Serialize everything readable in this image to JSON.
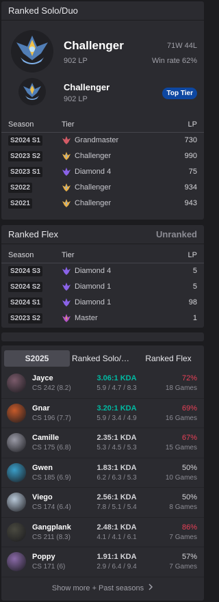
{
  "solo": {
    "title": "Ranked Solo/Duo",
    "tier": "Challenger",
    "lp": "902 LP",
    "record": "71W 44L",
    "winrate": "Win rate 62%",
    "secondary_tier": "Challenger",
    "secondary_lp": "902 LP",
    "badge": "Top Tier",
    "headers": {
      "season": "Season",
      "tier": "Tier",
      "lp": "LP"
    },
    "rows": [
      {
        "season": "S2024 S1",
        "tier": "Grandmaster",
        "lp": "730",
        "icon": "grandmaster-icon",
        "color": "#d35b66"
      },
      {
        "season": "S2023 S2",
        "tier": "Challenger",
        "lp": "990",
        "icon": "challenger-icon",
        "color": "#e8b04a"
      },
      {
        "season": "S2023 S1",
        "tier": "Diamond 4",
        "lp": "75",
        "icon": "diamond-icon",
        "color": "#8a63e8"
      },
      {
        "season": "S2022",
        "tier": "Challenger",
        "lp": "934",
        "icon": "challenger-icon",
        "color": "#e8b04a"
      },
      {
        "season": "S2021",
        "tier": "Challenger",
        "lp": "943",
        "icon": "challenger-icon",
        "color": "#e8b04a"
      }
    ]
  },
  "flex": {
    "title": "Ranked Flex",
    "status": "Unranked",
    "headers": {
      "season": "Season",
      "tier": "Tier",
      "lp": "LP"
    },
    "rows": [
      {
        "season": "S2024 S3",
        "tier": "Diamond 4",
        "lp": "5",
        "icon": "diamond-icon",
        "color": "#8a63e8"
      },
      {
        "season": "S2024 S2",
        "tier": "Diamond 1",
        "lp": "5",
        "icon": "diamond-icon",
        "color": "#8a63e8"
      },
      {
        "season": "S2024 S1",
        "tier": "Diamond 1",
        "lp": "98",
        "icon": "diamond-icon",
        "color": "#8a63e8"
      },
      {
        "season": "S2023 S2",
        "tier": "Master",
        "lp": "1",
        "icon": "master-icon",
        "color": "#b555c7"
      }
    ]
  },
  "champions": {
    "tabs": [
      "S2025",
      "Ranked Solo/D...",
      "Ranked Flex"
    ],
    "list": [
      {
        "name": "Jayce",
        "cs": "CS 242 (8.2)",
        "kda": "3.06:1 KDA",
        "kda_detail": "5.9 / 4.7 / 8.3",
        "winrate": "72%",
        "games": "18 Games",
        "kda_hl": true,
        "wr_hot": true,
        "color": "#7a5a6a"
      },
      {
        "name": "Gnar",
        "cs": "CS 196 (7.7)",
        "kda": "3.20:1 KDA",
        "kda_detail": "5.9 / 3.4 / 4.9",
        "winrate": "69%",
        "games": "16 Games",
        "kda_hl": true,
        "wr_hot": true,
        "color": "#c65a2a"
      },
      {
        "name": "Camille",
        "cs": "CS 175 (6.8)",
        "kda": "2.35:1 KDA",
        "kda_detail": "5.3 / 4.5 / 5.3",
        "winrate": "67%",
        "games": "15 Games",
        "kda_hl": false,
        "wr_hot": true,
        "color": "#9a9aa6"
      },
      {
        "name": "Gwen",
        "cs": "CS 185 (6.9)",
        "kda": "1.83:1 KDA",
        "kda_detail": "6.2 / 6.3 / 5.3",
        "winrate": "50%",
        "games": "10 Games",
        "kda_hl": false,
        "wr_hot": false,
        "color": "#3a9ec8"
      },
      {
        "name": "Viego",
        "cs": "CS 174 (6.4)",
        "kda": "2.56:1 KDA",
        "kda_detail": "7.8 / 5.1 / 5.4",
        "winrate": "50%",
        "games": "8 Games",
        "kda_hl": false,
        "wr_hot": false,
        "color": "#b8c8d8"
      },
      {
        "name": "Gangplank",
        "cs": "CS 211 (8.3)",
        "kda": "2.48:1 KDA",
        "kda_detail": "4.1 / 4.1 / 6.1",
        "winrate": "86%",
        "games": "7 Games",
        "kda_hl": false,
        "wr_hot": true,
        "color": "#4a4a40"
      },
      {
        "name": "Poppy",
        "cs": "CS 171 (6)",
        "kda": "1.91:1 KDA",
        "kda_detail": "2.9 / 6.4 / 9.4",
        "winrate": "57%",
        "games": "7 Games",
        "kda_hl": false,
        "wr_hot": false,
        "color": "#8a6aa8"
      }
    ],
    "show_more": "Show more + Past seasons"
  }
}
